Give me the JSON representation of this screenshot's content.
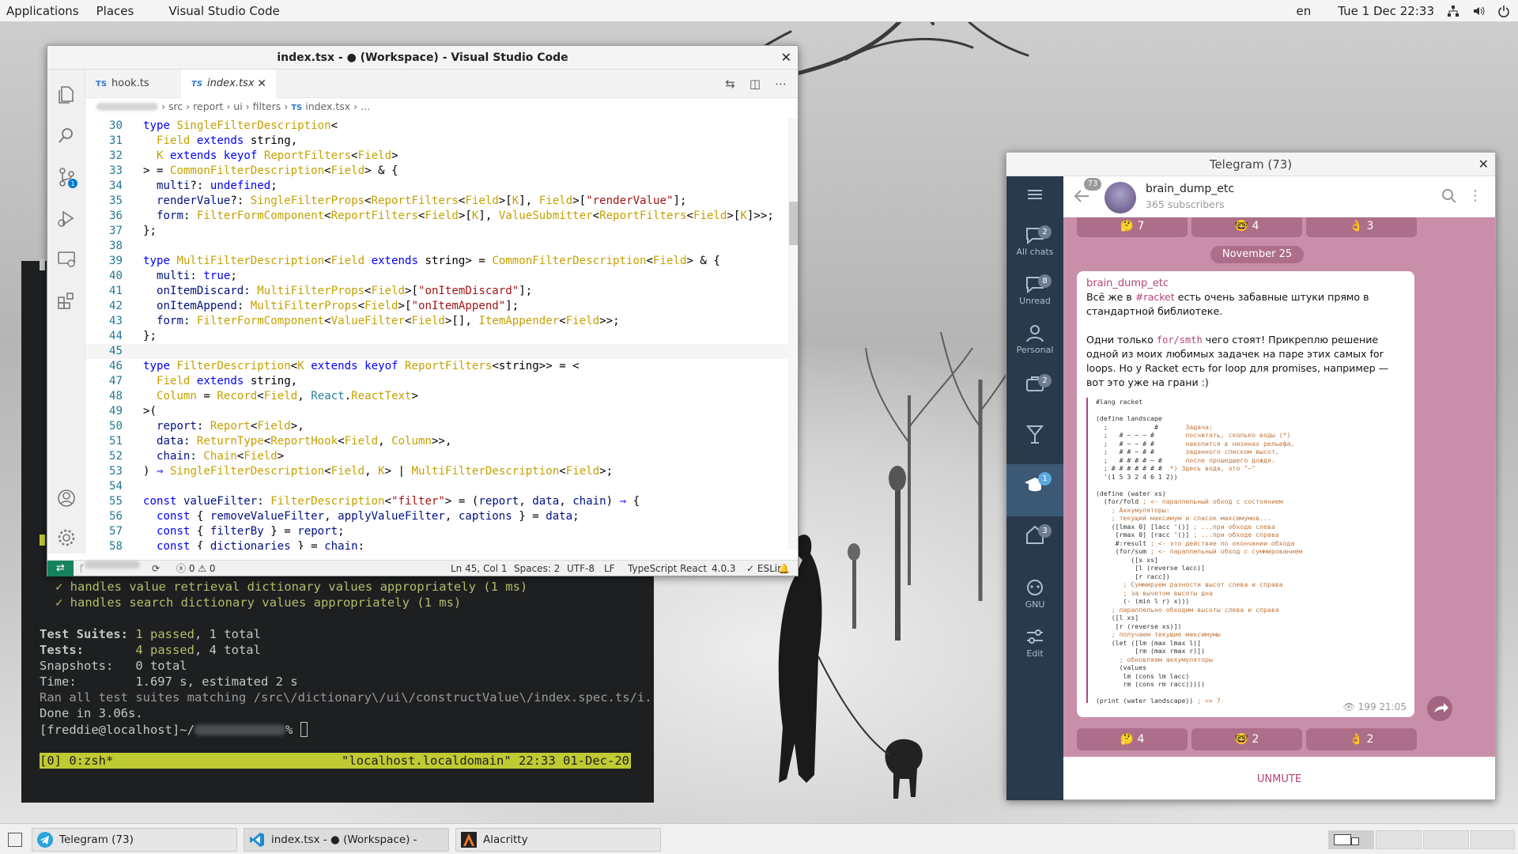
{
  "topbar": {
    "applications": "Applications",
    "places": "Places",
    "app": "Visual Studio Code",
    "lang": "en",
    "clock": "Tue 1 Dec  22:33"
  },
  "terminal": {
    "lines": [
      "✓ handles value retrieval dictionary values appropriately (1 ms)",
      "✓ handles search dictionary values appropriately (1 ms)",
      "Test Suites:",
      "1 passed",
      ", 1 total",
      "Tests:",
      "4 passed",
      ", 4 total",
      "Snapshots:   0 total",
      "Time:        1.697 s, estimated 2 s",
      "Ran all test suites matching /src\\/dictionary\\/ui\\/constructValue\\/index.spec.ts/i.",
      "Done in 3.06s.",
      "[freddie@localhost]~/",
      "%"
    ],
    "tmux_left": "[0] 0:zsh*",
    "tmux_right": "\"localhost.localdomain\" 22:33 01-Dec-20"
  },
  "vscode": {
    "title": "index.tsx - ● (Workspace) - Visual Studio Code",
    "tabs": [
      {
        "badge": "TS",
        "label": "hook.ts"
      },
      {
        "badge": "TS",
        "label": "index.tsx"
      }
    ],
    "breadcrumb": [
      "src",
      "report",
      "ui",
      "filters",
      "index.tsx",
      "..."
    ],
    "status": {
      "errors": "ⓧ 0 ⚠ 0",
      "position": "Ln 45, Col 1",
      "spaces": "Spaces: 2",
      "encoding": "UTF-8",
      "eol": "LF",
      "language": "TypeScript React",
      "version": "4.0.3",
      "eslint": "✓ ESLint"
    },
    "line_numbers": [
      "30",
      "31",
      "32",
      "33",
      "34",
      "35",
      "36",
      "37",
      "38",
      "39",
      "40",
      "41",
      "42",
      "43",
      "44",
      "45",
      "46",
      "47",
      "48",
      "49",
      "50",
      "51",
      "52",
      "53",
      "54",
      "55",
      "56",
      "57",
      "58"
    ]
  },
  "telegram": {
    "window_title": "Telegram (73)",
    "sidebar": [
      {
        "label": "",
        "badge": ""
      },
      {
        "label": "All chats",
        "badge": "2"
      },
      {
        "label": "Unread",
        "badge": "8"
      },
      {
        "label": "Personal",
        "badge": ""
      },
      {
        "label": "",
        "badge": "2"
      },
      {
        "label": "",
        "badge": ""
      },
      {
        "label": "",
        "badge": "1"
      },
      {
        "label": "",
        "badge": "3"
      },
      {
        "label": "GNU",
        "badge": ""
      },
      {
        "label": "Edit",
        "badge": ""
      }
    ],
    "back_badge": "73",
    "channel_name": "brain_dump_etc",
    "subscribers": "365 subscribers",
    "top_reactions": [
      "🤔 7",
      "🤓 4",
      "👌 3"
    ],
    "date": "November 25",
    "message": {
      "author": "brain_dump_etc",
      "p1_a": "Всё же в ",
      "p1_tag": "#racket",
      "p1_b": " есть очень забавные штуки прямо в стандартной библиотеке.",
      "p2_a": "Одни только ",
      "p2_code": "for/smth",
      "p2_b": " чего стоят! Прикреплю решение одной из моих любимых задачек на паре этих самых for loops. Но у Racket есть for loop для promises, например — вот это уже на грани :)",
      "views": "199",
      "time": "21:05"
    },
    "bottom_reactions": [
      "🤔 4",
      "🤓 2",
      "👌 2"
    ],
    "unmute": "UNMUTE"
  },
  "taskbar": [
    {
      "label": "Telegram (73)"
    },
    {
      "label": "index.tsx - ● (Workspace) - Visual ..."
    },
    {
      "label": "Alacritty"
    }
  ]
}
